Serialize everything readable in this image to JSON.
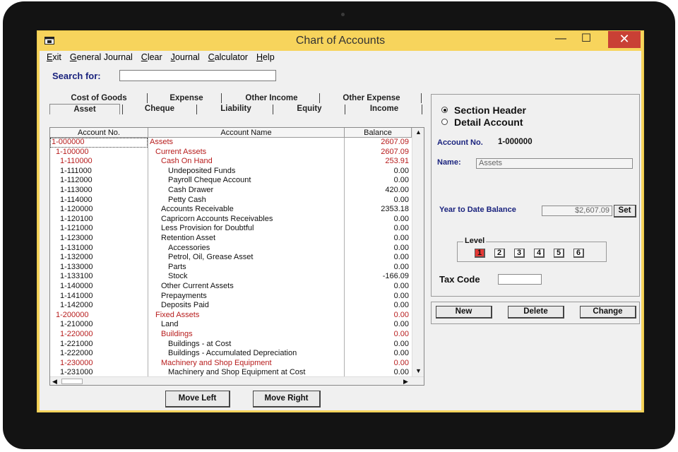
{
  "window": {
    "title": "Chart of Accounts"
  },
  "menu": [
    "Exit",
    "General Journal",
    "Clear",
    "Journal",
    "Calculator",
    "Help"
  ],
  "search": {
    "label": "Search for:",
    "value": ""
  },
  "tabs": {
    "row1": [
      "Cost of Goods",
      "Expense",
      "Other Income",
      "Other Expense"
    ],
    "row2": [
      "Asset",
      "Cheque",
      "Liability",
      "Equity",
      "Income"
    ]
  },
  "grid": {
    "headers": [
      "Account No.",
      "Account Name",
      "Balance"
    ],
    "rows": [
      {
        "no": "1-000000",
        "name": "Assets",
        "bal": "2607.09",
        "red": true,
        "indent": 0
      },
      {
        "no": "1-100000",
        "name": "Current Assets",
        "bal": "2607.09",
        "red": true,
        "indent": 1
      },
      {
        "no": "1-110000",
        "name": "Cash On Hand",
        "bal": "253.91",
        "red": true,
        "indent": 2
      },
      {
        "no": "1-111000",
        "name": "Undeposited Funds",
        "bal": "0.00",
        "red": false,
        "indent": 3
      },
      {
        "no": "1-112000",
        "name": "Payroll Cheque Account",
        "bal": "0.00",
        "red": false,
        "indent": 3
      },
      {
        "no": "1-113000",
        "name": "Cash Drawer",
        "bal": "420.00",
        "red": false,
        "indent": 3
      },
      {
        "no": "1-114000",
        "name": "Petty Cash",
        "bal": "0.00",
        "red": false,
        "indent": 3
      },
      {
        "no": "1-120000",
        "name": "Accounts Receivable",
        "bal": "2353.18",
        "red": false,
        "indent": 2
      },
      {
        "no": "1-120100",
        "name": "Capricorn Accounts Receivables",
        "bal": "0.00",
        "red": false,
        "indent": 2
      },
      {
        "no": "1-121000",
        "name": "Less Provision for Doubtful",
        "bal": "0.00",
        "red": false,
        "indent": 2
      },
      {
        "no": "1-123000",
        "name": "Retention Asset",
        "bal": "0.00",
        "red": false,
        "indent": 2
      },
      {
        "no": "1-131000",
        "name": "Accessories",
        "bal": "0.00",
        "red": false,
        "indent": 3
      },
      {
        "no": "1-132000",
        "name": "Petrol, Oil, Grease Asset",
        "bal": "0.00",
        "red": false,
        "indent": 3
      },
      {
        "no": "1-133000",
        "name": "Parts",
        "bal": "0.00",
        "red": false,
        "indent": 3
      },
      {
        "no": "1-133100",
        "name": "Stock",
        "bal": "-166.09",
        "red": false,
        "indent": 3
      },
      {
        "no": "1-140000",
        "name": "Other Current Assets",
        "bal": "0.00",
        "red": false,
        "indent": 2
      },
      {
        "no": "1-141000",
        "name": "Prepayments",
        "bal": "0.00",
        "red": false,
        "indent": 2
      },
      {
        "no": "1-142000",
        "name": "Deposits Paid",
        "bal": "0.00",
        "red": false,
        "indent": 2
      },
      {
        "no": "1-200000",
        "name": "Fixed Assets",
        "bal": "0.00",
        "red": true,
        "indent": 1
      },
      {
        "no": "1-210000",
        "name": "Land",
        "bal": "0.00",
        "red": false,
        "indent": 2
      },
      {
        "no": "1-220000",
        "name": "Buildings",
        "bal": "0.00",
        "red": true,
        "indent": 2
      },
      {
        "no": "1-221000",
        "name": "Buildings - at Cost",
        "bal": "0.00",
        "red": false,
        "indent": 3
      },
      {
        "no": "1-222000",
        "name": "Buildings - Accumulated Depreciation",
        "bal": "0.00",
        "red": false,
        "indent": 3
      },
      {
        "no": "1-230000",
        "name": "Machinery and Shop Equipment",
        "bal": "0.00",
        "red": true,
        "indent": 2
      },
      {
        "no": "1-231000",
        "name": "Machinery and Shop Equipment at Cost",
        "bal": "0.00",
        "red": false,
        "indent": 3
      }
    ]
  },
  "buttons": {
    "move_left": "Move Left",
    "move_right": "Move Right",
    "new": "New",
    "delete": "Delete",
    "change": "Change",
    "set": "Set"
  },
  "detail": {
    "radio_section": "Section Header",
    "radio_detail": "Detail Account",
    "selected": "section",
    "account_label": "Account No.",
    "account_value": "1-000000",
    "name_label": "Name:",
    "name_value": "Assets",
    "ytd_label": "Year to Date Balance",
    "ytd_value": "$2,607.09",
    "level_label": "Level",
    "levels": [
      "1",
      "2",
      "3",
      "4",
      "5",
      "6"
    ],
    "level_selected": 1,
    "tax_label": "Tax Code",
    "tax_value": ""
  },
  "colors": {
    "titlebar": "#f7d45c",
    "red_text": "#b71c1c",
    "blue_label": "#1a237e",
    "level_selected": "#e53935",
    "close_button": "#c94035"
  }
}
